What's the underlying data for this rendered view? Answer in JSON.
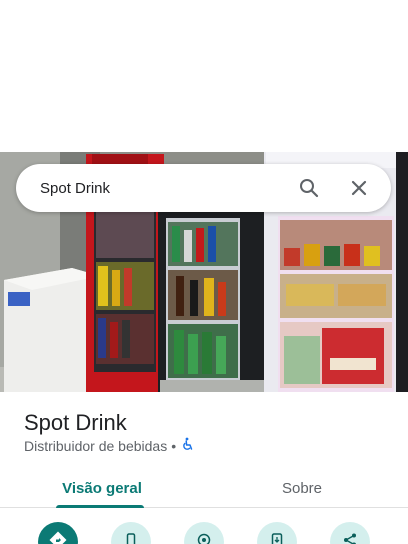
{
  "search": {
    "query": "Spot Drink"
  },
  "place": {
    "name": "Spot Drink",
    "category": "Distribuidor de bebidas",
    "separator": "•",
    "wheelchair_icon": "wheelchair-icon"
  },
  "tabs": [
    {
      "label": "Visão geral",
      "active": true
    },
    {
      "label": "Sobre",
      "active": false
    }
  ],
  "actions": [
    {
      "icon": "directions-icon",
      "primary": true
    },
    {
      "icon": "phone-icon",
      "primary": false
    },
    {
      "icon": "save-icon",
      "primary": false
    },
    {
      "icon": "send-to-phone-icon",
      "primary": false
    },
    {
      "icon": "share-icon",
      "primary": false
    }
  ],
  "colors": {
    "accent": "#0b7a75",
    "accent_light": "#d4efed",
    "wheelchair_icon": "#1a73e8"
  }
}
